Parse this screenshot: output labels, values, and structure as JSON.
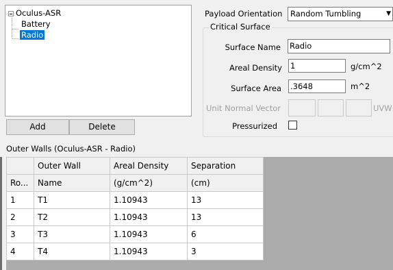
{
  "tree": {
    "root": "Oculus-ASR",
    "children": [
      "Battery",
      "Radio"
    ],
    "selected": "Radio"
  },
  "buttons": {
    "add": "Add",
    "delete": "Delete"
  },
  "payload": {
    "label": "Payload Orientation",
    "value": "Random Tumbling"
  },
  "critical_surface": {
    "title": "Critical Surface",
    "surface_name_label": "Surface Name",
    "surface_name_value": "Radio",
    "areal_density_label": "Areal Density",
    "areal_density_value": "1",
    "areal_density_unit": "g/cm^2",
    "surface_area_label": "Surface Area",
    "surface_area_value": ".3648",
    "surface_area_unit": "m^2",
    "unit_normal_label": "Unit Normal Vector",
    "unit_normal_suffix": "UVW",
    "pressurized_label": "Pressurized",
    "pressurized_checked": false
  },
  "outer_walls_label": "Outer Walls (Oculus-ASR - Radio)",
  "grid": {
    "headers": [
      [
        "",
        "Outer Wall",
        "Areal Density",
        "Separation"
      ],
      [
        "Ro...",
        "Name",
        "(g/cm^2)",
        "(cm)"
      ]
    ],
    "rows": [
      [
        "1",
        "T1",
        "1.10943",
        "13"
      ],
      [
        "2",
        "T2",
        "1.10943",
        "13"
      ],
      [
        "3",
        "T3",
        "1.10943",
        "6"
      ],
      [
        "4",
        "T4",
        "1.10943",
        "3"
      ]
    ]
  }
}
